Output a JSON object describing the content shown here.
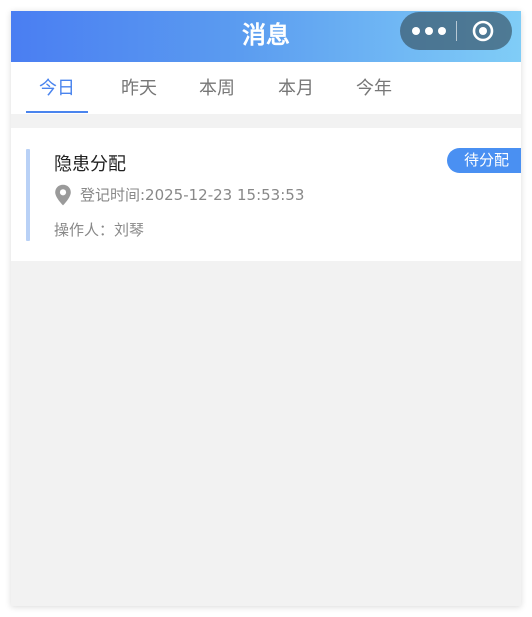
{
  "header": {
    "title": "消息",
    "capsule_more_icon": "more-dots-icon",
    "capsule_close_icon": "target-circle-icon"
  },
  "tabs": [
    {
      "label": "今日",
      "active": true
    },
    {
      "label": "昨天",
      "active": false
    },
    {
      "label": "本周",
      "active": false
    },
    {
      "label": "本月",
      "active": false
    },
    {
      "label": "今年",
      "active": false
    }
  ],
  "messages": [
    {
      "title": "隐患分配",
      "status": "待分配",
      "time_text": "登记时间:2025-12-23 15:53:53",
      "operator_text": "操作人：刘琴",
      "icon": "location-pin-icon"
    }
  ],
  "colors": {
    "accent": "#4a84ee",
    "status_pill": "#4a90f2",
    "header_gradient_start": "#4a7ef2",
    "header_gradient_end": "#80cdf7",
    "background": "#f2f2f2"
  }
}
